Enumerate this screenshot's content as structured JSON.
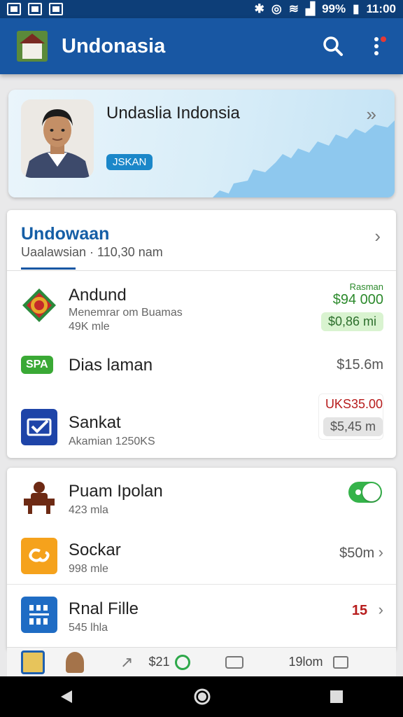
{
  "status_bar": {
    "battery": "99%",
    "time": "11:00"
  },
  "app_bar": {
    "title": "Undonasia"
  },
  "profile": {
    "name": "Undaslia Indonsia",
    "badge": "JSKAN"
  },
  "section": {
    "title": "Undowaan",
    "subtitle": "Uaalawsian · 110,30 nam"
  },
  "items": [
    {
      "title": "Andund",
      "subtitle": "Menemrar om Buamas",
      "meta": "49K mle",
      "top_label": "Rasman",
      "top_value": "$94 000",
      "pill": "$0,86 mi"
    },
    {
      "tag": "SPA",
      "title": "Dias laman",
      "value": "$15.6m"
    },
    {
      "title": "Sankat",
      "subtitle": "Akamian 1250KS",
      "top_value": "UKS35.00",
      "pill": "$5,45 m"
    }
  ],
  "items2": [
    {
      "title": "Puam Ipolan",
      "subtitle": "423 mla"
    },
    {
      "title": "Sockar",
      "subtitle": "998 mle",
      "value": "$50m"
    },
    {
      "title": "Rnal Fille",
      "subtitle": "545 lhla",
      "value": "15"
    }
  ],
  "bottom_strip": {
    "value1": "$21",
    "value2": "19lom"
  },
  "colors": {
    "primary": "#1857a3",
    "status": "#0d3e78",
    "accent_green": "#3aa935",
    "accent_red": "#b71c1c"
  }
}
